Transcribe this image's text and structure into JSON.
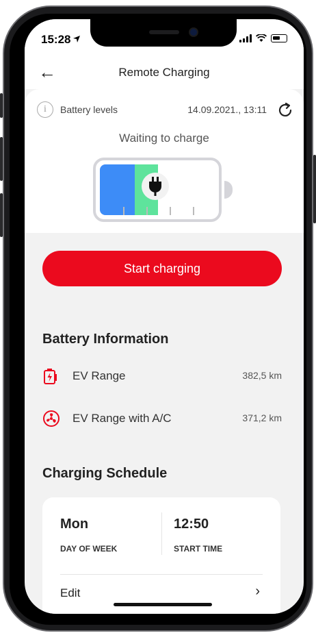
{
  "status_bar": {
    "time": "15:28"
  },
  "header": {
    "title": "Remote Charging"
  },
  "battery_levels": {
    "label": "Battery levels",
    "timestamp": "14.09.2021., 13:11",
    "state": "Waiting to charge",
    "charged_fraction": 0.3,
    "target_fraction": 0.5
  },
  "actions": {
    "start_label": "Start charging"
  },
  "battery_info": {
    "heading": "Battery Information",
    "items": [
      {
        "label": "EV Range",
        "value": "382,5 km",
        "icon": "battery-charge-icon"
      },
      {
        "label": "EV Range with A/C",
        "value": "371,2 km",
        "icon": "fan-icon"
      }
    ]
  },
  "schedule": {
    "heading": "Charging Schedule",
    "day": "Mon",
    "day_label": "DAY OF WEEK",
    "time": "12:50",
    "time_label": "START TIME",
    "edit_label": "Edit"
  },
  "colors": {
    "accent": "#eb0a1e",
    "charged": "#3d8cf7",
    "target": "#5ee39c"
  }
}
